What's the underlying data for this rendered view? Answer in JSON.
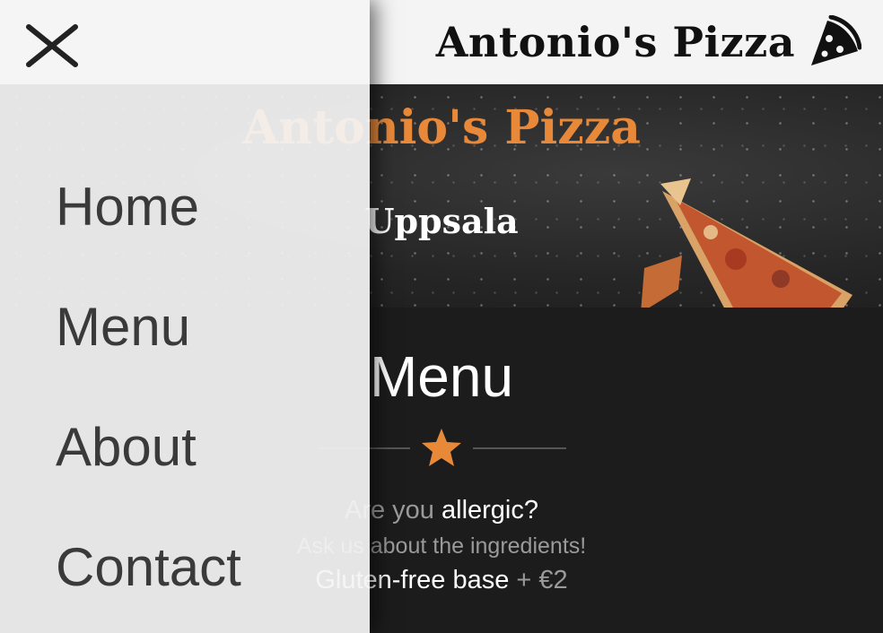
{
  "header": {
    "brand_title": "Antonio's Pizza",
    "brand_icon": "pizza-slice-icon"
  },
  "hero": {
    "title": "Antonio's Pizza",
    "city": "Uppsala"
  },
  "menu_section": {
    "title": "Menu",
    "divider_icon": "star-icon",
    "allergy_prefix": "Are you",
    "allergy_highlight": "allergic?",
    "ingredients_note": "Ask us about the ingredients!",
    "gluten_label": "Gluten-free base",
    "gluten_price": "+ €2"
  },
  "drawer": {
    "close_icon": "close-icon",
    "nav": [
      {
        "label": "Home"
      },
      {
        "label": "Menu"
      },
      {
        "label": "About"
      },
      {
        "label": "Contact"
      }
    ]
  },
  "colors": {
    "accent": "#e8893a",
    "header_bg": "#f4f4f4",
    "page_bg": "#1c1c1c",
    "nav_text": "#3a3a3a"
  }
}
